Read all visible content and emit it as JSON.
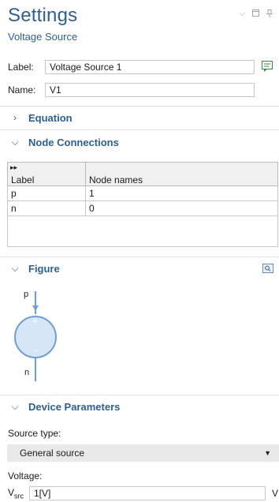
{
  "header": {
    "title": "Settings",
    "subtitle": "Voltage Source",
    "controls": [
      "chevron-down-icon",
      "restore-icon",
      "pin-icon"
    ]
  },
  "fields": {
    "label": {
      "caption": "Label:",
      "value": "Voltage Source 1"
    },
    "name": {
      "caption": "Name:",
      "value": "V1"
    }
  },
  "sections": {
    "equation": {
      "title": "Equation",
      "expanded": false
    },
    "node_connections": {
      "title": "Node Connections",
      "expanded": true
    },
    "figure": {
      "title": "Figure",
      "expanded": true
    },
    "device_parameters": {
      "title": "Device Parameters",
      "expanded": true
    }
  },
  "node_table": {
    "columns": [
      "Label",
      "Node names"
    ],
    "rows": [
      {
        "label": "p",
        "node": "1"
      },
      {
        "label": "n",
        "node": "0"
      }
    ]
  },
  "figure": {
    "top_terminal": "p",
    "bottom_terminal": "n",
    "plus_sign": "+",
    "minus_sign": "-",
    "fill_color": "#d7e6f7",
    "stroke_color": "#6c9fd6"
  },
  "device_parameters": {
    "source_type_label": "Source type:",
    "source_type_value": "General source",
    "voltage_label": "Voltage:",
    "voltage_symbol": "V",
    "voltage_subscript": "src",
    "voltage_value": "1[V]",
    "voltage_unit": "V"
  },
  "colors": {
    "accent": "#2e5f93"
  }
}
